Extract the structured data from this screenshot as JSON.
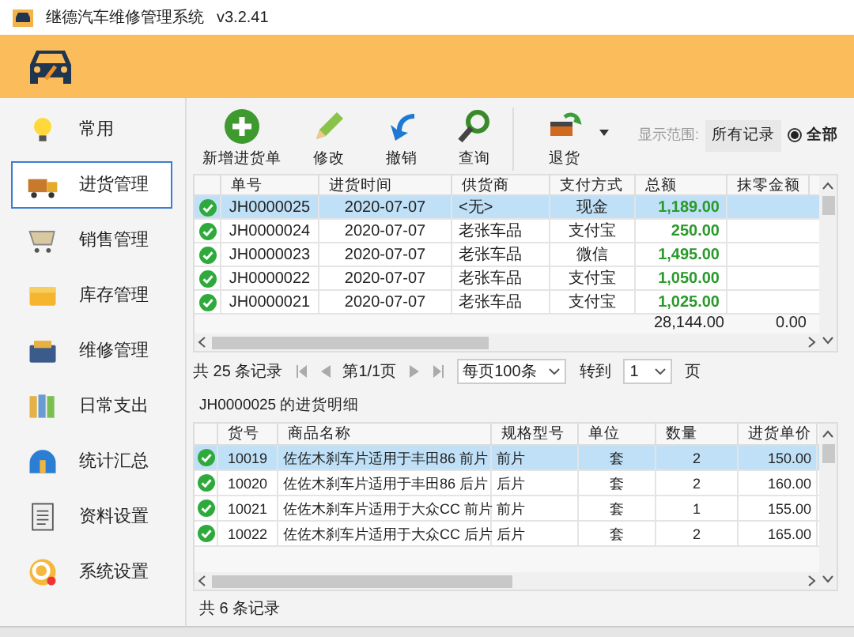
{
  "window": {
    "title": "继德汽车维修管理系统",
    "version": "v3.2.41"
  },
  "sidebar": {
    "items": [
      {
        "label": "常用",
        "selected": false
      },
      {
        "label": "进货管理",
        "selected": true
      },
      {
        "label": "销售管理",
        "selected": false
      },
      {
        "label": "库存管理",
        "selected": false
      },
      {
        "label": "维修管理",
        "selected": false
      },
      {
        "label": "日常支出",
        "selected": false
      },
      {
        "label": "统计汇总",
        "selected": false
      },
      {
        "label": "资料设置",
        "selected": false
      },
      {
        "label": "系统设置",
        "selected": false
      }
    ]
  },
  "toolbar": {
    "buttons": [
      {
        "label": "新增进货单",
        "dropdown": false
      },
      {
        "label": "修改",
        "dropdown": false
      },
      {
        "label": "撤销",
        "dropdown": false
      },
      {
        "label": "查询",
        "dropdown": false
      },
      {
        "label": "退货",
        "dropdown": true
      }
    ],
    "range_label": "显示范围:",
    "range_value": "所有记录",
    "radio": {
      "label": "全部",
      "selected": true
    }
  },
  "orders": {
    "columns": [
      "单号",
      "进货时间",
      "供货商",
      "支付方式",
      "总额",
      "抹零金额"
    ],
    "rows": [
      {
        "cells": [
          "JH0000025",
          "2020-07-07",
          "<无>",
          "现金",
          "1,189.00"
        ],
        "selected": true
      },
      {
        "cells": [
          "JH0000024",
          "2020-07-07",
          "老张车品",
          "支付宝",
          "250.00"
        ],
        "selected": false
      },
      {
        "cells": [
          "JH0000023",
          "2020-07-07",
          "老张车品",
          "微信",
          "1,495.00"
        ],
        "selected": false
      },
      {
        "cells": [
          "JH0000022",
          "2020-07-07",
          "老张车品",
          "支付宝",
          "1,050.00"
        ],
        "selected": false
      },
      {
        "cells": [
          "JH0000021",
          "2020-07-07",
          "老张车品",
          "支付宝",
          "1,025.00"
        ],
        "selected": false
      }
    ],
    "totals": [
      "28,144.00",
      "0.00"
    ]
  },
  "pager": {
    "count": "共 25 条记录",
    "page": "第1/1页",
    "per_page": "每页100条",
    "goto_label": "转到",
    "goto_value": "1",
    "page_unit": "页"
  },
  "details": {
    "title": "JH0000025 的进货明细",
    "columns": [
      "货号",
      "商品名称",
      "规格型号",
      "单位",
      "数量",
      "进货单价"
    ],
    "rows": [
      {
        "cells": [
          "10019",
          "佐佐木刹车片适用于丰田86 前片",
          "前片",
          "套",
          "2",
          "150.00"
        ],
        "selected": true
      },
      {
        "cells": [
          "10020",
          "佐佐木刹车片适用于丰田86 后片",
          "后片",
          "套",
          "2",
          "160.00"
        ],
        "selected": false
      },
      {
        "cells": [
          "10021",
          "佐佐木刹车片适用于大众CC 前片",
          "前片",
          "套",
          "1",
          "155.00"
        ],
        "selected": false
      },
      {
        "cells": [
          "10022",
          "佐佐木刹车片适用于大众CC 后片",
          "后片",
          "套",
          "2",
          "165.00"
        ],
        "selected": false
      }
    ],
    "count": "共 6 条记录"
  }
}
